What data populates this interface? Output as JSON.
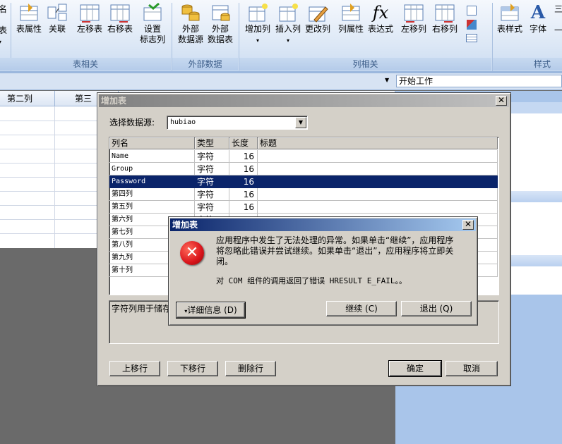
{
  "ribbon": {
    "partial_left": {
      "top": "名",
      "mid": "表"
    },
    "buttons": [
      {
        "label1": "表属性",
        "label2": "",
        "icon": "table-properties-icon"
      },
      {
        "label1": "关联",
        "label2": "",
        "icon": "relation-icon"
      },
      {
        "label1": "左移表",
        "label2": "",
        "icon": "move-table-left-icon"
      },
      {
        "label1": "右移表",
        "label2": "",
        "icon": "move-table-right-icon"
      },
      {
        "label1": "设置",
        "label2": "标志列",
        "icon": "set-flag-column-icon"
      },
      {
        "label1": "外部",
        "label2": "数据源",
        "icon": "external-datasource-icon"
      },
      {
        "label1": "外部",
        "label2": "数据表",
        "icon": "external-table-icon"
      },
      {
        "label1": "增加列",
        "label2": "",
        "icon": "add-column-icon"
      },
      {
        "label1": "插入列",
        "label2": "",
        "icon": "insert-column-icon"
      },
      {
        "label1": "更改列",
        "label2": "",
        "icon": "edit-column-icon"
      },
      {
        "label1": "列属性",
        "label2": "",
        "icon": "column-properties-icon"
      },
      {
        "label1": "表达式",
        "label2": "",
        "icon": "expression-icon"
      },
      {
        "label1": "左移列",
        "label2": "",
        "icon": "move-column-left-icon"
      },
      {
        "label1": "右移列",
        "label2": "",
        "icon": "move-column-right-icon"
      },
      {
        "label1": "表样式",
        "label2": "",
        "icon": "table-style-icon"
      },
      {
        "label1": "字体",
        "label2": "",
        "icon": "font-icon"
      }
    ],
    "groups": [
      "表相关",
      "外部数据",
      "列相关",
      "样式"
    ],
    "fx_glyph": "fx",
    "font_glyph": "A",
    "dropdown_arrow": "▾",
    "accent": "#3e5f8a"
  },
  "formula_bar": {
    "cell_value": "开始工作",
    "arrow": "▼"
  },
  "grid": {
    "col2": "第二列",
    "col3": "第三"
  },
  "add_table_dialog": {
    "title": "增加表",
    "close_glyph": "✕",
    "datasource_label": "选择数据源:",
    "datasource_value": "hubiao",
    "combo_arrow": "▼",
    "headers": [
      "列名",
      "类型",
      "长度",
      "标题"
    ],
    "rows": [
      {
        "name": "Name",
        "type": "字符",
        "length": "16",
        "caption": ""
      },
      {
        "name": "Group",
        "type": "字符",
        "length": "16",
        "caption": ""
      },
      {
        "name": "Password",
        "type": "字符",
        "length": "16",
        "caption": ""
      },
      {
        "name": "第四列",
        "type": "字符",
        "length": "16",
        "caption": ""
      },
      {
        "name": "第五列",
        "type": "字符",
        "length": "16",
        "caption": ""
      },
      {
        "name": "第六列",
        "type": "字符",
        "length": "",
        "caption": ""
      },
      {
        "name": "第七列",
        "type": "",
        "length": "",
        "caption": ""
      },
      {
        "name": "第八列",
        "type": "",
        "length": "",
        "caption": ""
      },
      {
        "name": "第九列",
        "type": "",
        "length": "",
        "caption": ""
      },
      {
        "name": "第十列",
        "type": "",
        "length": "",
        "caption": ""
      }
    ],
    "description": "字符列用于储存",
    "buttons": {
      "up": "上移行",
      "down": "下移行",
      "delete": "删除行",
      "ok": "确定",
      "cancel": "取消"
    }
  },
  "error_dialog": {
    "title": "增加表",
    "close_glyph": "✕",
    "message": "应用程序中发生了无法处理的异常。如果单击“继续”，应用程序将忽略此错误并尝试继续。如果单击“退出”，应用程序将立即关闭。",
    "detail": "对 COM 组件的调用返回了错误 HRESULT E_FAIL。。",
    "buttons": {
      "details": "详细信息 (D)",
      "continue": "继续 (C)",
      "quit": "退出 (Q)"
    },
    "details_arrow": "▾",
    "error_glyph": "✕",
    "error_color": "#d9141b"
  },
  "colors": {
    "selection": "#0a246a",
    "titlebar": "#0a246a",
    "titlebar_end": "#a6caf0",
    "inactive_title": "#808080"
  }
}
